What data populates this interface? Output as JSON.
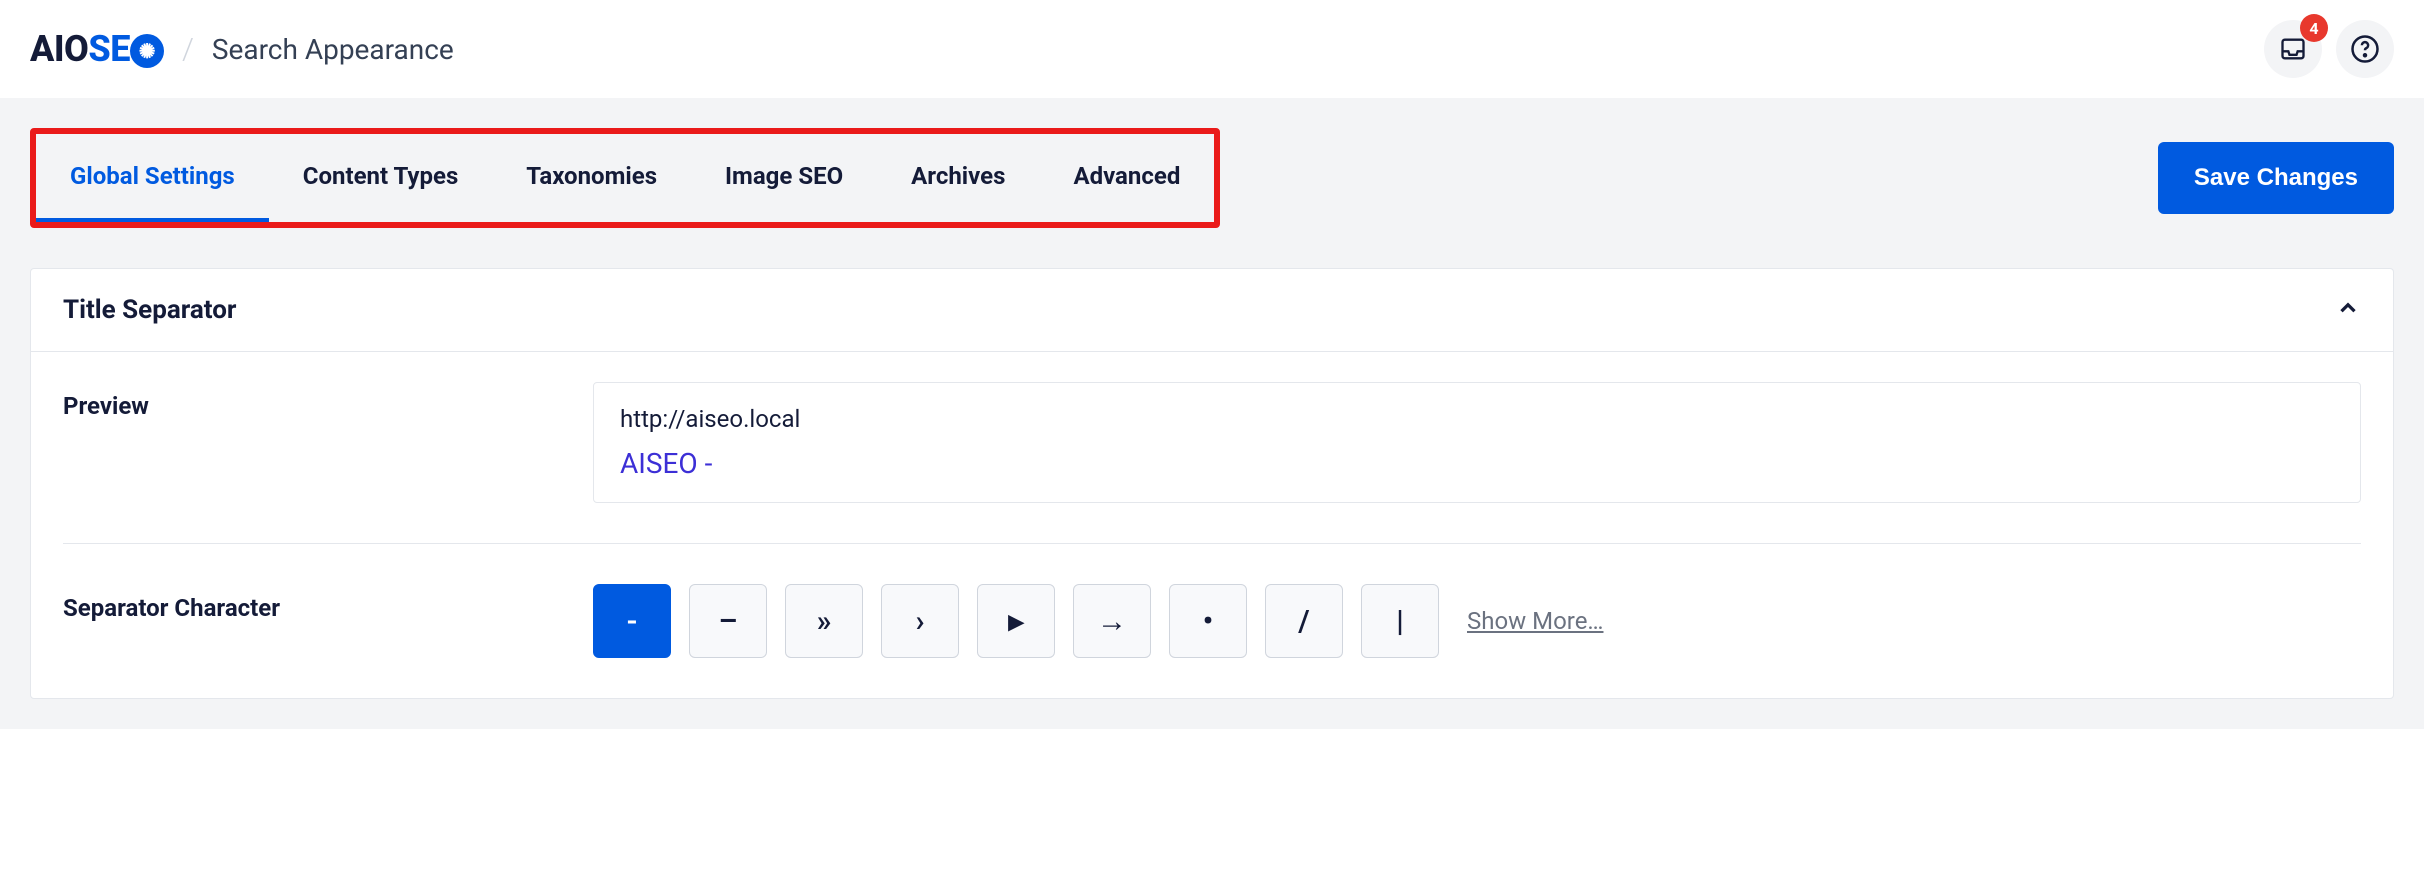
{
  "header": {
    "logo": {
      "part1": "AIO",
      "part2": "SE"
    },
    "page_title": "Search Appearance",
    "notification_count": "4"
  },
  "tabs": [
    {
      "label": "Global Settings",
      "active": true
    },
    {
      "label": "Content Types",
      "active": false
    },
    {
      "label": "Taxonomies",
      "active": false
    },
    {
      "label": "Image SEO",
      "active": false
    },
    {
      "label": "Archives",
      "active": false
    },
    {
      "label": "Advanced",
      "active": false
    }
  ],
  "actions": {
    "save": "Save Changes"
  },
  "panel": {
    "title": "Title Separator",
    "preview_label": "Preview",
    "preview_url": "http://aiseo.local",
    "preview_title": "AISEO -",
    "separator_label": "Separator Character",
    "separators": [
      "-",
      "–",
      "»",
      "›",
      "▸",
      "→",
      "•",
      "/",
      "|"
    ],
    "active_separator_index": 0,
    "show_more": "Show More…"
  }
}
